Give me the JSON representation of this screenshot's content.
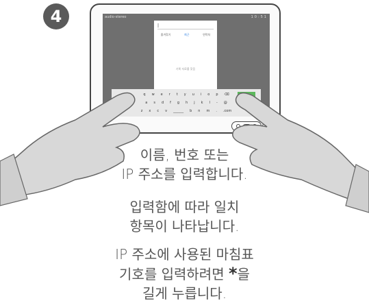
{
  "step_number": "4",
  "device": {
    "status_left": "audio-stereo",
    "status_time": "10:51",
    "input_cursor": "|",
    "tabs": [
      "즐겨찾기",
      "최근",
      "연락처"
    ],
    "hint": "기록 자료를 찾음",
    "keyboard_rows": [
      [
        "q",
        "w",
        "e",
        "r",
        "t",
        "y",
        "u",
        "i",
        "o",
        "p",
        "⌫"
      ],
      [
        "a",
        "s",
        "d",
        "f",
        "g",
        "h",
        "j",
        "k",
        "l",
        "-",
        "@"
      ],
      [
        "z",
        "x",
        "c",
        "v",
        "______",
        "b",
        "n",
        "m",
        ".",
        ".com"
      ]
    ]
  },
  "captions": {
    "line1": "이름, 번호 또는",
    "line2": "IP 주소를 입력합니다.",
    "line3": "입력함에 따라 일치",
    "line4": "항목이 나타납니다.",
    "line5": "IP 주소에 사용된 마침표",
    "line6a": "기호를 입력하려면 ",
    "star": "*",
    "line6b": "을",
    "line7": "길게 누릅니다."
  }
}
